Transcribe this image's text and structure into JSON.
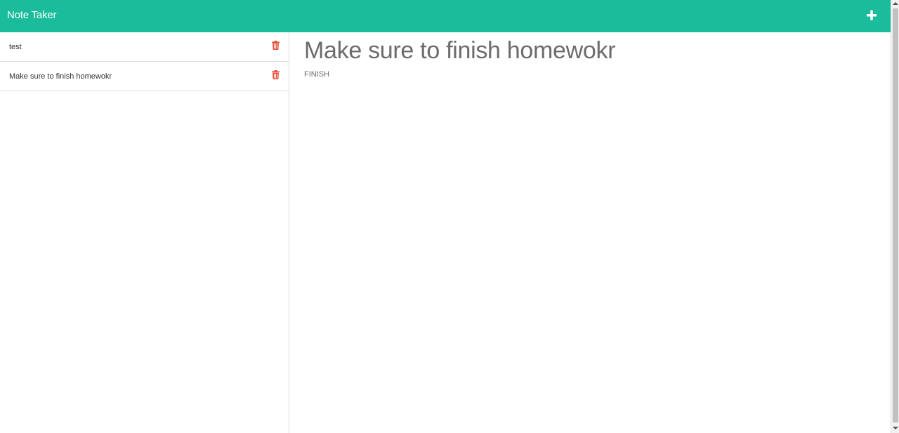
{
  "header": {
    "title": "Note Taker",
    "new_note_icon": "plus-icon"
  },
  "sidebar": {
    "notes": [
      {
        "title": "test",
        "delete_icon": "trash-icon"
      },
      {
        "title": "Make sure to finish homewokr",
        "delete_icon": "trash-icon"
      }
    ]
  },
  "detail": {
    "title": "Make sure to finish homewokr",
    "body": "FINISH"
  },
  "colors": {
    "navbar": "#1abc9c",
    "delete": "#e74c3c",
    "detail_text": "#6c6c6c"
  }
}
